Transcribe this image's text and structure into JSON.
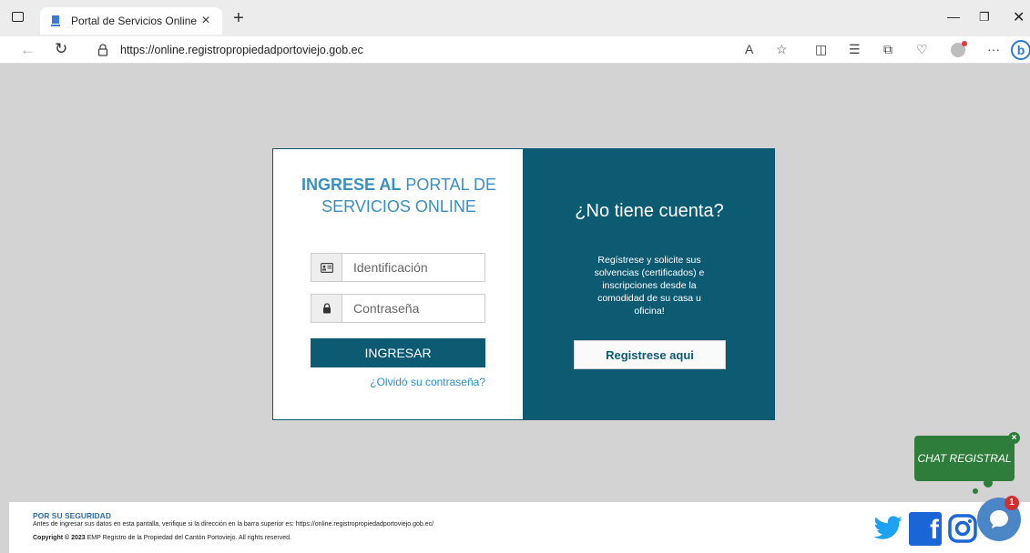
{
  "browser": {
    "tab_title": "Portal de Servicios Online",
    "tab_close": "×",
    "new_tab": "+",
    "url": "https://online.registropropiedadportoviejo.gob.ec"
  },
  "login": {
    "title_bold": "INGRESE AL",
    "title_rest": " PORTAL DE SERVICIOS ONLINE",
    "id_placeholder": "Identificación",
    "password_placeholder": "Contraseña",
    "submit_label": "INGRESAR",
    "forgot_link": "¿Olvidó su contraseña?"
  },
  "register": {
    "heading": "¿No tiene cuenta?",
    "description": "Regístrese y solicite sus solvencias (certificados) e inscripciones desde la comodidad de su casa u oficina!",
    "button_label": "Registrese aqui"
  },
  "chat": {
    "bubble_text": "CHAT REGISTRAL",
    "close_label": "×",
    "badge_count": "1"
  },
  "footer": {
    "security_title": "POR SU SEGURIDAD",
    "security_text": "Antes de ingresar sus datos en esta pantalla, verifique si la dirección en la barra superior es: https://online.registropropiedadportoviejo.gob.ec/",
    "copyright_bold": "Copyright © 2023",
    "copyright_rest": " EMP Registro de la Propiedad del Cantón Portoviejo. All rights reserved."
  },
  "colors": {
    "brand_teal": "#0d5a73",
    "title_blue": "#3a8fc1",
    "chat_green": "#2e7d3a"
  }
}
